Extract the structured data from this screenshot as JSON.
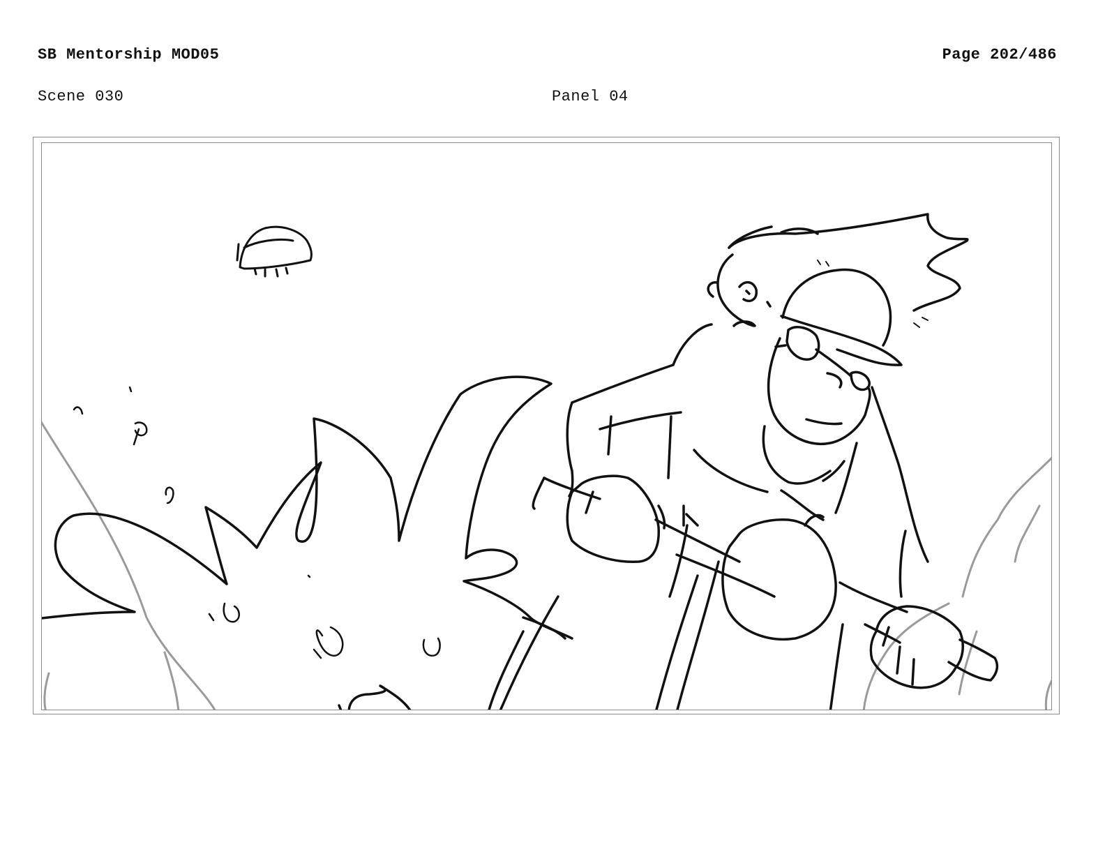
{
  "header": {
    "project_title": "SB Mentorship MOD05",
    "page_number": "Page 202/486"
  },
  "subheader": {
    "scene": "Scene 030",
    "panel": "Panel 04"
  },
  "panel": {
    "border_color": "#8a8a8a",
    "line_color": "#111111",
    "background_line_color": "#9a9a9a"
  }
}
